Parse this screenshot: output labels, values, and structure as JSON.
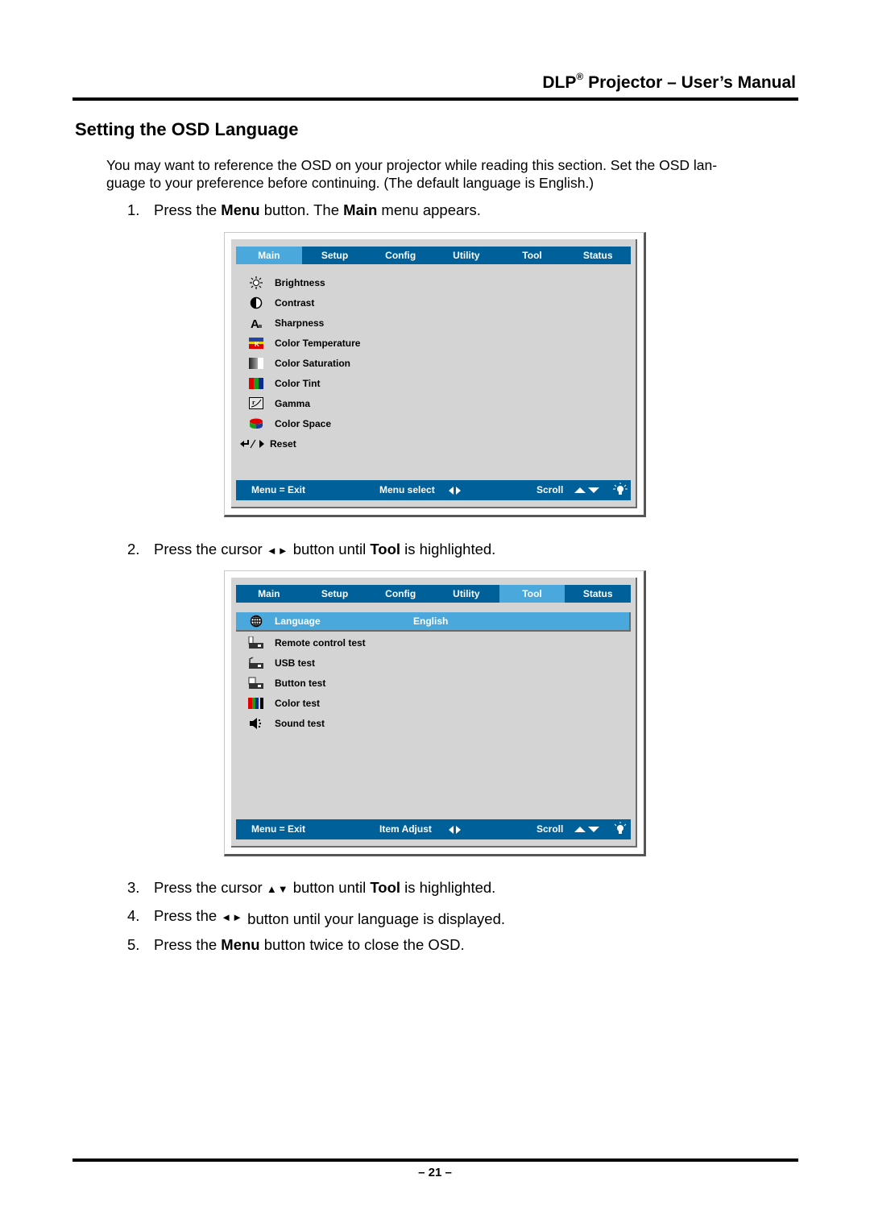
{
  "header": {
    "title_prefix": "DLP",
    "title_sup": "®",
    "title_suffix": " Projector – User’s Manual"
  },
  "section": {
    "title": "Setting the OSD Language",
    "intro_line1": "You may want to reference the OSD on your projector while reading this section. Set the OSD lan-",
    "intro_line2": "guage to your preference before continuing. (The default language is English.)"
  },
  "steps": [
    {
      "num": "1.",
      "parts": [
        "Press the ",
        "Menu",
        " button. The ",
        "Main",
        " menu appears."
      ]
    },
    {
      "num": "2.",
      "parts": [
        "Press the cursor ",
        "◄►",
        " button until ",
        "Tool",
        " is highlighted."
      ]
    },
    {
      "num": "3.",
      "parts": [
        "Press the cursor ",
        "▲▼",
        " button until ",
        "Tool",
        " is highlighted."
      ]
    },
    {
      "num": "4.",
      "parts": [
        "Press the ",
        "◄►",
        " button until your language is displayed."
      ]
    },
    {
      "num": "5.",
      "parts": [
        "Press the ",
        "Menu",
        " button twice to close the OSD."
      ]
    }
  ],
  "osd_main": {
    "tabs": [
      "Main",
      "Setup",
      "Config",
      "Utility",
      "Tool",
      "Status"
    ],
    "active_tab": "Main",
    "items": [
      {
        "icon": "brightness-icon",
        "label": "Brightness"
      },
      {
        "icon": "contrast-icon",
        "label": "Contrast"
      },
      {
        "icon": "sharpness-icon",
        "label": "Sharpness"
      },
      {
        "icon": "color-temperature-icon",
        "label": "Color Temperature"
      },
      {
        "icon": "color-saturation-icon",
        "label": "Color Saturation"
      },
      {
        "icon": "color-tint-icon",
        "label": "Color Tint"
      },
      {
        "icon": "gamma-icon",
        "label": "Gamma"
      },
      {
        "icon": "color-space-icon",
        "label": "Color Space"
      },
      {
        "icon": "reset-icon",
        "label": "Reset"
      }
    ],
    "footer": {
      "exit": "Menu = Exit",
      "select": "Menu select",
      "scroll": "Scroll"
    }
  },
  "osd_tool": {
    "tabs": [
      "Main",
      "Setup",
      "Config",
      "Utility",
      "Tool",
      "Status"
    ],
    "active_tab": "Tool",
    "items": [
      {
        "icon": "language-icon",
        "label": "Language",
        "value": "English",
        "selected": true
      },
      {
        "icon": "remote-control-test-icon",
        "label": "Remote control test"
      },
      {
        "icon": "usb-test-icon",
        "label": "USB test"
      },
      {
        "icon": "button-test-icon",
        "label": "Button test"
      },
      {
        "icon": "color-test-icon",
        "label": "Color test"
      },
      {
        "icon": "sound-test-icon",
        "label": "Sound test"
      }
    ],
    "footer": {
      "exit": "Menu = Exit",
      "select": "Item Adjust",
      "scroll": "Scroll"
    }
  },
  "footer": {
    "page_number": "– 21 –"
  },
  "colors": {
    "osd_bar": "#00609a",
    "osd_highlight": "#4aa8dc",
    "osd_bg": "#d4d4d4"
  }
}
